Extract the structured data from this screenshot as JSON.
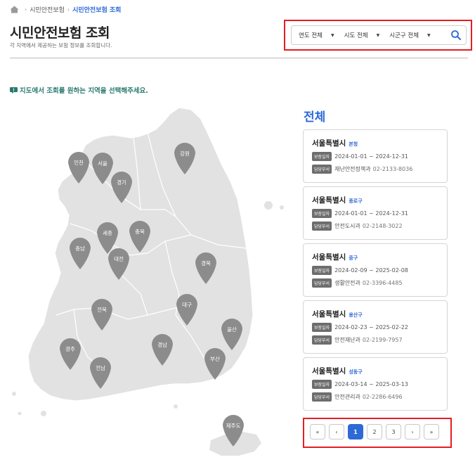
{
  "breadcrumb": {
    "items": [
      "시민안전보험",
      "시민안전보험 조회"
    ]
  },
  "header": {
    "title": "시민안전보험 조회",
    "subtitle": "각 지역에서 제공하는 보험 정보를 조회합니다."
  },
  "filters": {
    "year": "연도 전체",
    "province": "시도 전체",
    "district": "시군구 전체",
    "search_icon": "search-icon"
  },
  "notice": {
    "text": "지도에서 조회를 원하는 지역을 선택해주세요."
  },
  "map": {
    "fill_color": "#e2e2e2",
    "pin_color": "#8c8c8c",
    "pins": [
      "인천",
      "서울",
      "경기",
      "강원",
      "세종",
      "충북",
      "충남",
      "대전",
      "경북",
      "대구",
      "전북",
      "울산",
      "경남",
      "광주",
      "전남",
      "부산",
      "제주도"
    ]
  },
  "list": {
    "region_title": "전체",
    "period_badge": "보장일자",
    "dept_badge": "담당부서",
    "cards": [
      {
        "city": "서울특별시",
        "district": "본청",
        "period": "2024-01-01 ~ 2024-12-31",
        "dept": "재난안전정책과",
        "phone": "02-2133-8036"
      },
      {
        "city": "서울특별시",
        "district": "종로구",
        "period": "2024-01-01 ~ 2024-12-31",
        "dept": "안전도시과",
        "phone": "02-2148-3022"
      },
      {
        "city": "서울특별시",
        "district": "중구",
        "period": "2024-02-09 ~ 2025-02-08",
        "dept": "생활안전과",
        "phone": "02-3396-4485"
      },
      {
        "city": "서울특별시",
        "district": "용산구",
        "period": "2024-02-23 ~ 2025-02-22",
        "dept": "안전재난과",
        "phone": "02-2199-7957"
      },
      {
        "city": "서울특별시",
        "district": "성동구",
        "period": "2024-03-14 ~ 2025-03-13",
        "dept": "안전관리과",
        "phone": "02-2286-6496"
      }
    ]
  },
  "pagination": {
    "first": "«",
    "prev": "‹",
    "pages": [
      "1",
      "2",
      "3"
    ],
    "current": "1",
    "next": "›",
    "last": "»"
  },
  "colors": {
    "accent": "#2d6ad6",
    "highlight": "#e31e24",
    "notice": "#2a7a6e"
  }
}
